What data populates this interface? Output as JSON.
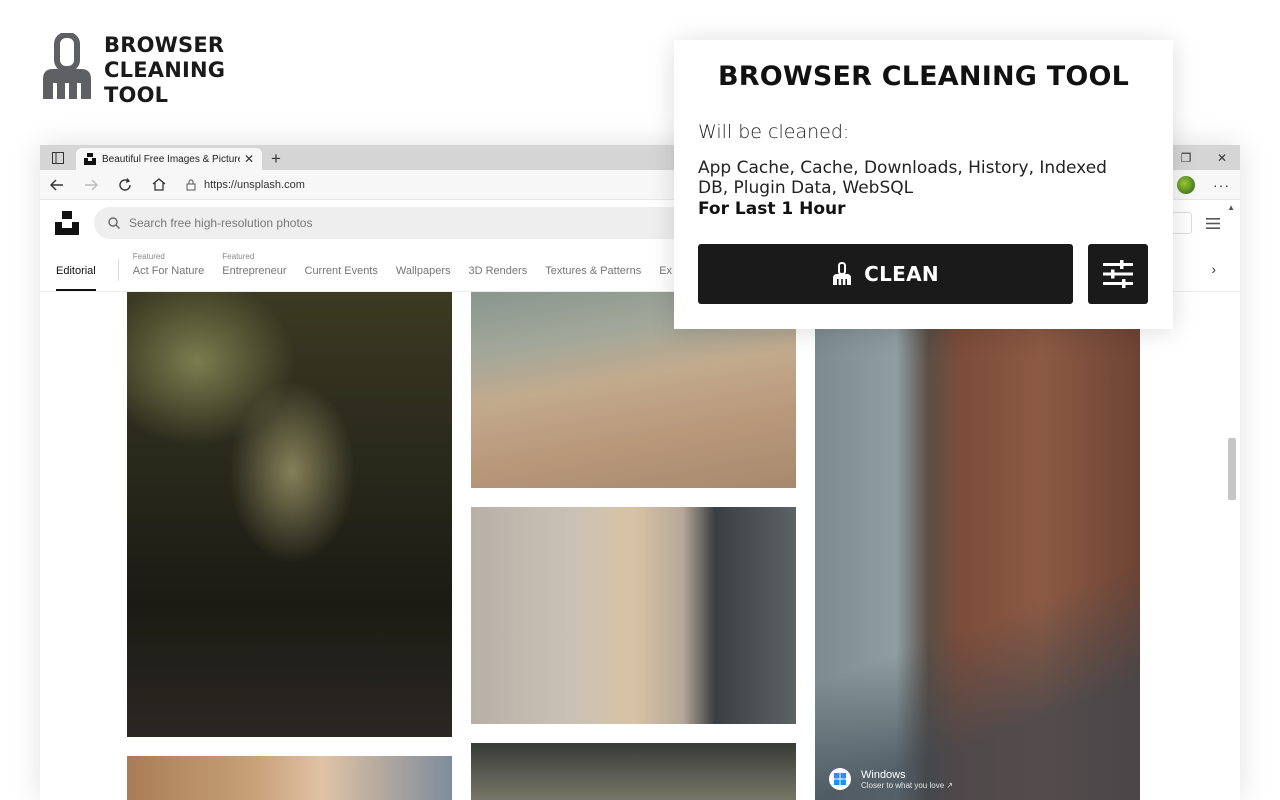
{
  "brand": {
    "lines": [
      "BROWSER",
      "CLEANING",
      "TOOL"
    ],
    "icon": "broom-icon"
  },
  "browser": {
    "tab": {
      "title": "Beautiful Free Images & Pictures",
      "close": "✕"
    },
    "new_tab": "+",
    "address": {
      "url": "https://unsplash.com"
    },
    "window_controls": {
      "restore": "❐",
      "close": "✕"
    },
    "menu_dots": "···"
  },
  "page": {
    "search_placeholder": "Search free high-resolution photos",
    "nav": [
      {
        "label": "Editorial",
        "featured": ""
      },
      {
        "label": "Act For Nature",
        "featured": "Featured"
      },
      {
        "label": "Entrepreneur",
        "featured": "Featured"
      },
      {
        "label": "Current Events",
        "featured": ""
      },
      {
        "label": "Wallpapers",
        "featured": ""
      },
      {
        "label": "3D Renders",
        "featured": ""
      },
      {
        "label": "Textures & Patterns",
        "featured": ""
      },
      {
        "label": "Ex",
        "featured": ""
      }
    ],
    "nav_more": "›",
    "ad": {
      "name": "Windows",
      "tagline": "Closer to what you love ↗"
    }
  },
  "popup": {
    "title": "BROWSER CLEANING TOOL",
    "will_be_cleaned": "Will be cleaned:",
    "items": "App Cache, Cache, Downloads, History, Indexed DB, Plugin Data, WebSQL",
    "period": "For Last 1 Hour",
    "clean_label": "CLEAN",
    "settings_icon": "sliders-icon"
  },
  "colors": {
    "button_bg": "#1a1a1a",
    "brand_text": "#1a1a1a"
  }
}
